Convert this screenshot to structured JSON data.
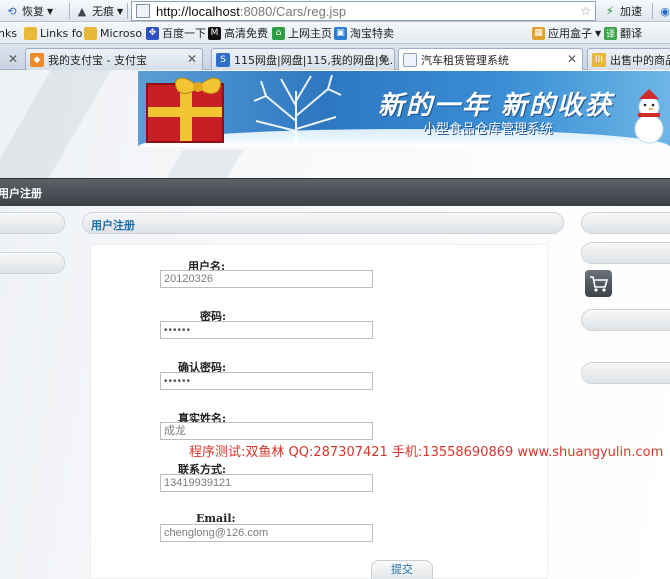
{
  "toolbar": {
    "restore_label": "恢复",
    "nomark_label": "无痕",
    "url_host": "http://localhost",
    "url_rest": ":8080/Cars/reg.jsp",
    "accelerate_label": "加速"
  },
  "favorites": {
    "items": [
      {
        "label": "nks"
      },
      {
        "label": "Links fo"
      },
      {
        "label": "Microso"
      },
      {
        "label": "百度一下"
      },
      {
        "label": "高清免费"
      },
      {
        "label": "上网主页"
      },
      {
        "label": "淘宝特卖"
      }
    ],
    "app_box_label": "应用盒子",
    "translate_label": "翻译"
  },
  "tabs": [
    {
      "label": "我的支付宝 - 支付宝"
    },
    {
      "label": "115网盘|网盘|115,我的网盘|免..."
    },
    {
      "label": "汽车租赁管理系统"
    },
    {
      "label": "出售中的商品"
    }
  ],
  "banner": {
    "title": "新的一年 新的收获",
    "subtitle": "小型食品仓库管理系统"
  },
  "nav": {
    "label": "用户注册"
  },
  "panel": {
    "title": "用户注册"
  },
  "form": {
    "fields": [
      {
        "label": "用户名:",
        "value": "20120326"
      },
      {
        "label": "密码:",
        "value": "••••••"
      },
      {
        "label": "确认密码:",
        "value": "••••••"
      },
      {
        "label": "真实姓名:",
        "value": "成龙"
      },
      {
        "label": "联系方式:",
        "value": "13419939121"
      },
      {
        "label": "Email:",
        "value": "chenglong@126.com"
      }
    ],
    "submit_label": "提交"
  },
  "watermark": "程序测试:双鱼林 QQ:287307421 手机:13558690869 www.shuangyulin.com",
  "colors": {
    "nav_bar": "#3f454b",
    "panel_title": "#1f6fa9",
    "watermark": "#d9362b"
  }
}
